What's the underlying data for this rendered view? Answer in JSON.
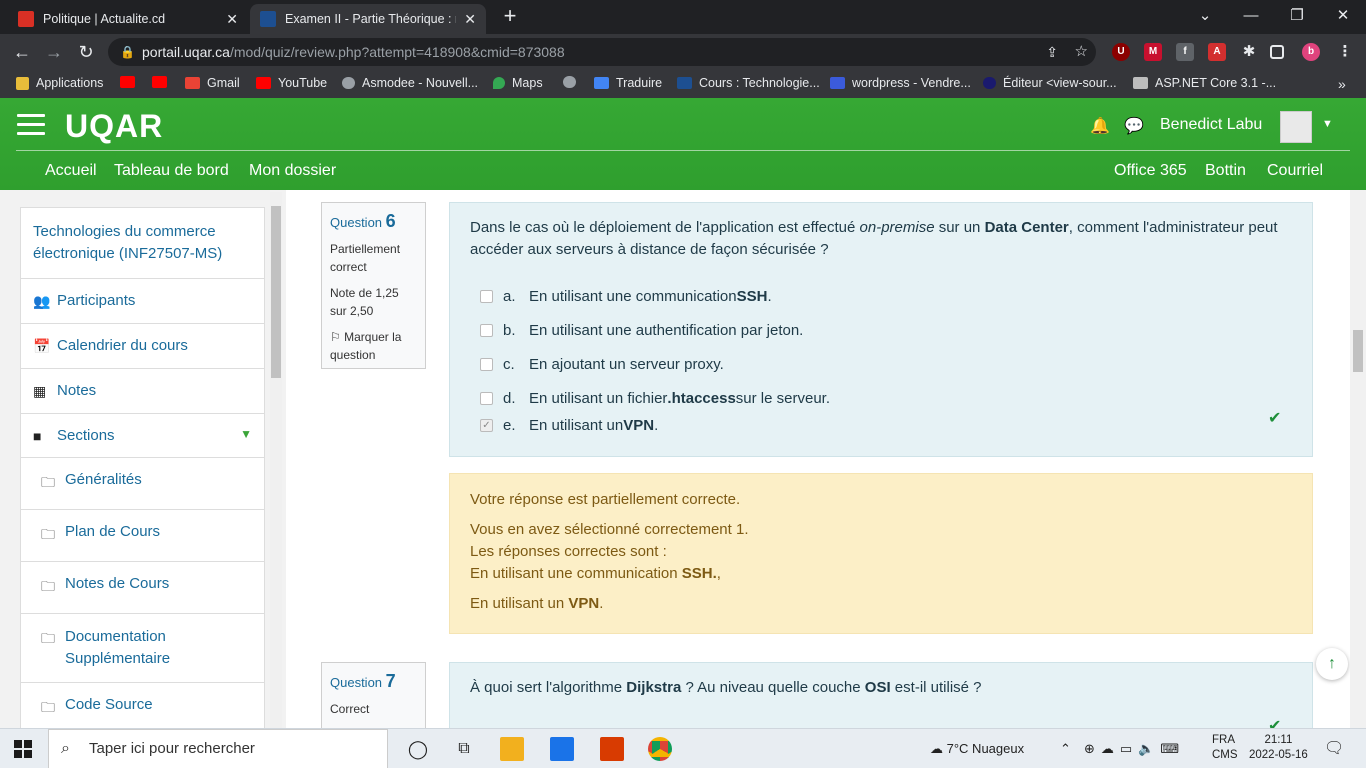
{
  "browser": {
    "tabs": [
      {
        "title": "Politique | Actualite.cd",
        "active": false
      },
      {
        "title": "Examen II - Partie Théorique : relecture",
        "active": true
      }
    ],
    "url_host": "portail.uqar.ca",
    "url_path": "/mod/quiz/review.php?attempt=418908&cmid=873088",
    "bookmarks": [
      "Applications",
      "Gmail",
      "YouTube",
      "Asmodee - Nouvell...",
      "Maps",
      "Traduire",
      "Cours : Technologie...",
      "wordpress - Vendre...",
      "Éditeur <view-sour...",
      "ASP.NET Core 3.1 -..."
    ]
  },
  "header": {
    "logo": "UQAR",
    "user_name": "Benedict Labu",
    "nav_left": [
      "Accueil",
      "Tableau de bord",
      "Mon dossier"
    ],
    "nav_right": [
      "Office 365",
      "Bottin",
      "Courriel"
    ]
  },
  "drawer": {
    "course": "Technologies du commerce électronique (INF27507-MS)",
    "items": [
      {
        "label": "Participants",
        "icon": "users-icon"
      },
      {
        "label": "Calendrier du cours",
        "icon": "calendar-icon"
      },
      {
        "label": "Notes",
        "icon": "table-icon"
      },
      {
        "label": "Sections",
        "icon": "folder-solid-icon"
      }
    ],
    "sections": [
      "Généralités",
      "Plan de Cours",
      "Notes de Cours",
      "Documentation Supplémentaire",
      "Code Source"
    ]
  },
  "q6": {
    "label": "Question",
    "number": "6",
    "state": "Partiellement correct",
    "grade": "Note de 1,25 sur 2,50",
    "flag": "Marquer la question",
    "text_before": "Dans le cas où le déploiement de l'application est effectué ",
    "text_em": "on-premise",
    "text_mid": " sur un ",
    "text_bold": "Data Center",
    "text_after": ", comment l'administrateur peut accéder aux serveurs à distance de façon sécurisée ?",
    "answers": [
      {
        "letter": "a.",
        "pre": "En utilisant une communication ",
        "bold": "SSH",
        "post": ".",
        "checked": false
      },
      {
        "letter": "b.",
        "pre": "En utilisant une authentification par jeton.",
        "bold": "",
        "post": "",
        "checked": false
      },
      {
        "letter": "c.",
        "pre": "En ajoutant un serveur proxy.",
        "bold": "",
        "post": "",
        "checked": false
      },
      {
        "letter": "d.",
        "pre": "En utilisant un fichier ",
        "bold": ".htaccess",
        "post": " sur le serveur.",
        "checked": false
      },
      {
        "letter": "e.",
        "pre": "En utilisant un ",
        "bold": "VPN",
        "post": ".",
        "checked": true
      }
    ],
    "feedback": {
      "line1": "Votre réponse est partiellement correcte.",
      "line2": "Vous en avez sélectionné correctement 1.",
      "line3": "Les réponses correctes sont :",
      "line4_pre": "En utilisant une communication ",
      "line4_bold": "SSH.",
      "line4_post": ",",
      "line5_pre": "En utilisant un ",
      "line5_bold": "VPN",
      "line5_post": "."
    }
  },
  "q7": {
    "label": "Question",
    "number": "7",
    "state": "Correct",
    "text_pre": "À quoi sert l'algorithme ",
    "text_b1": "Dijkstra",
    "text_mid": " ? Au niveau quelle couche ",
    "text_b2": "OSI",
    "text_after": " est-il utilisé ?"
  },
  "taskbar": {
    "search_placeholder": "Taper ici pour rechercher",
    "weather": "7°C  Nuageux",
    "lang1": "FRA",
    "lang2": "CMS",
    "time": "21:11",
    "date": "2022-05-16"
  }
}
